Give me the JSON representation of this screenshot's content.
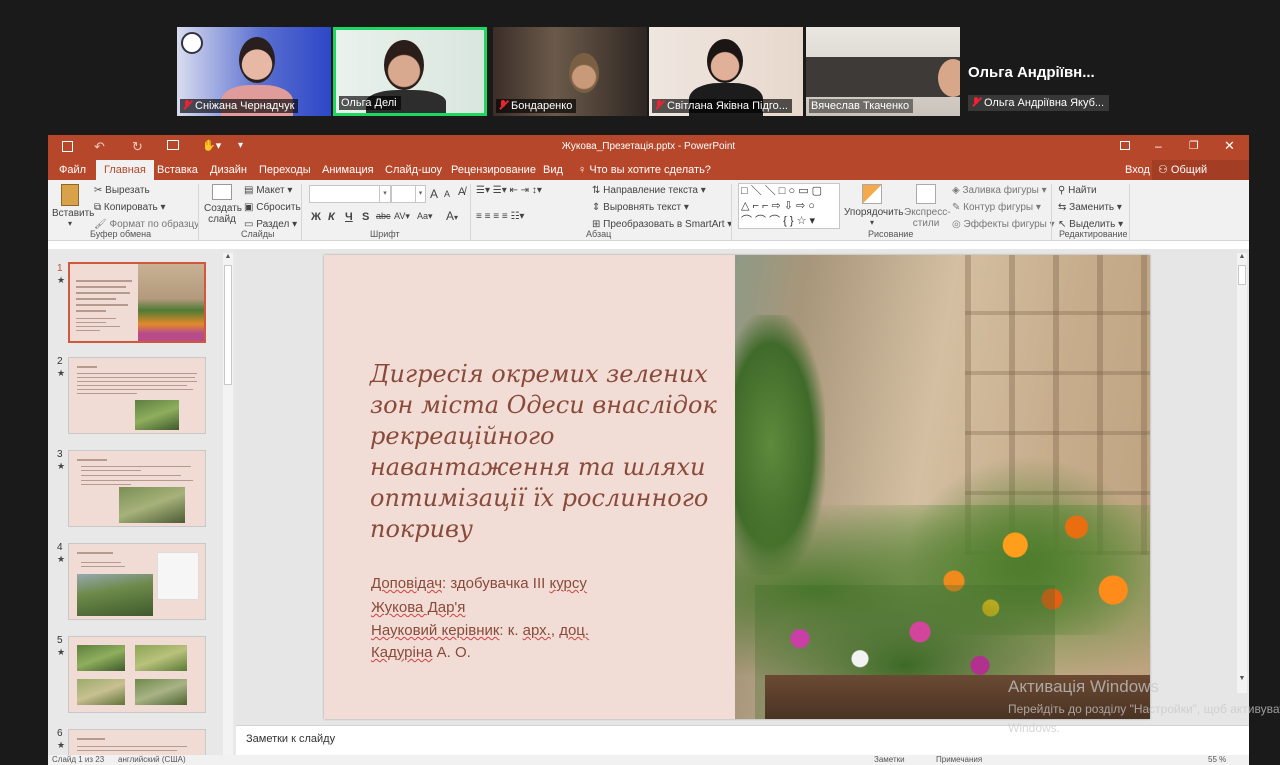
{
  "meeting": {
    "participants": [
      {
        "name": "Сніжана Чернадчук",
        "muted": true
      },
      {
        "name": "Ольга Делі",
        "muted": false,
        "active_speaker": true
      },
      {
        "name": "Бондаренко",
        "muted": true
      },
      {
        "name": "Світлана Яківна Підго...",
        "muted": true
      },
      {
        "name": "Вячеслав Ткаченко",
        "muted": false
      }
    ],
    "overflow_participant": {
      "title": "Ольга Андріївн...",
      "label": "Ольга Андріївна Якуб..."
    }
  },
  "app": {
    "title": "Жукова_Презетація.pptx  -  PowerPoint",
    "qat_icons": [
      "save-icon",
      "undo-icon",
      "redo-icon",
      "slideshow-icon",
      "touch-icon"
    ],
    "tabs": [
      "Файл",
      "Главная",
      "Вставка",
      "Дизайн",
      "Переходы",
      "Анимация",
      "Слайд-шоу",
      "Рецензирование",
      "Вид"
    ],
    "active_tab": "Главная",
    "tell_me": "Что вы хотите сделать?",
    "sign_in": "Вход",
    "share": "Общий доступ"
  },
  "ribbon": {
    "clipboard": {
      "paste": "Вставить",
      "cut": "Вырезать",
      "copy": "Копировать",
      "format_painter": "Формат по образцу",
      "group": "Буфер обмена"
    },
    "slides": {
      "new_slide": "Создать слайд",
      "layout": "Макет",
      "reset": "Сбросить",
      "section": "Раздел",
      "group": "Слайды"
    },
    "font": {
      "bold": "Ж",
      "italic": "К",
      "underline": "Ч",
      "shadow": "S",
      "strike": "abc",
      "spacing": "AV",
      "case": "Aa",
      "color": "A",
      "grow": "A",
      "shrink": "A",
      "group": "Шрифт"
    },
    "paragraph": {
      "text_direction": "Направление текста",
      "align_text": "Выровнять текст",
      "smartart": "Преобразовать в SmartArt",
      "group": "Абзац"
    },
    "drawing": {
      "arrange": "Упорядочить",
      "quick_styles": "Экспресс-стили",
      "fill": "Заливка фигуры",
      "outline": "Контур фигуры",
      "effects": "Эффекты фигуры",
      "group": "Рисование"
    },
    "editing": {
      "find": "Найти",
      "replace": "Заменить",
      "select": "Выделить",
      "group": "Редактирование"
    }
  },
  "thumbnails": [
    {
      "num": "1",
      "star": "★",
      "selected": true
    },
    {
      "num": "2",
      "star": "★",
      "selected": false
    },
    {
      "num": "3",
      "star": "★",
      "selected": false
    },
    {
      "num": "4",
      "star": "★",
      "selected": false
    },
    {
      "num": "5",
      "star": "★",
      "selected": false
    },
    {
      "num": "6",
      "star": "★",
      "selected": false
    }
  ],
  "slide": {
    "title": "Дигресія окремих зелених зон міста Одеси внаслідок рекреаційного навантаження та шляхи оптимізації їх рослинного покриву",
    "line1_label": "Доповідач",
    "line1_rest": ": здобувачка ІІІ ",
    "line1_word": "курсу",
    "line2": "Жукова Дар'я",
    "line3_label": "Науковий керівник",
    "line3_rest": ": к. ",
    "line3_a": "арх.",
    "line3_sep": ", ",
    "line3_b": "доц.",
    "line4_a": "Кадуріна",
    "line4_b": " А. О."
  },
  "notes_placeholder": "Заметки к слайду",
  "status": {
    "slide_counter": "Слайд 1 из 23",
    "language": "английский (США)",
    "notes": "Заметки",
    "comments": "Примечания",
    "zoom": "55 %"
  },
  "watermark": {
    "line1": "Активація Windows",
    "line2": "Перейдіть до розділу \"Настройки\", щоб активувати",
    "line3": "Windows."
  }
}
